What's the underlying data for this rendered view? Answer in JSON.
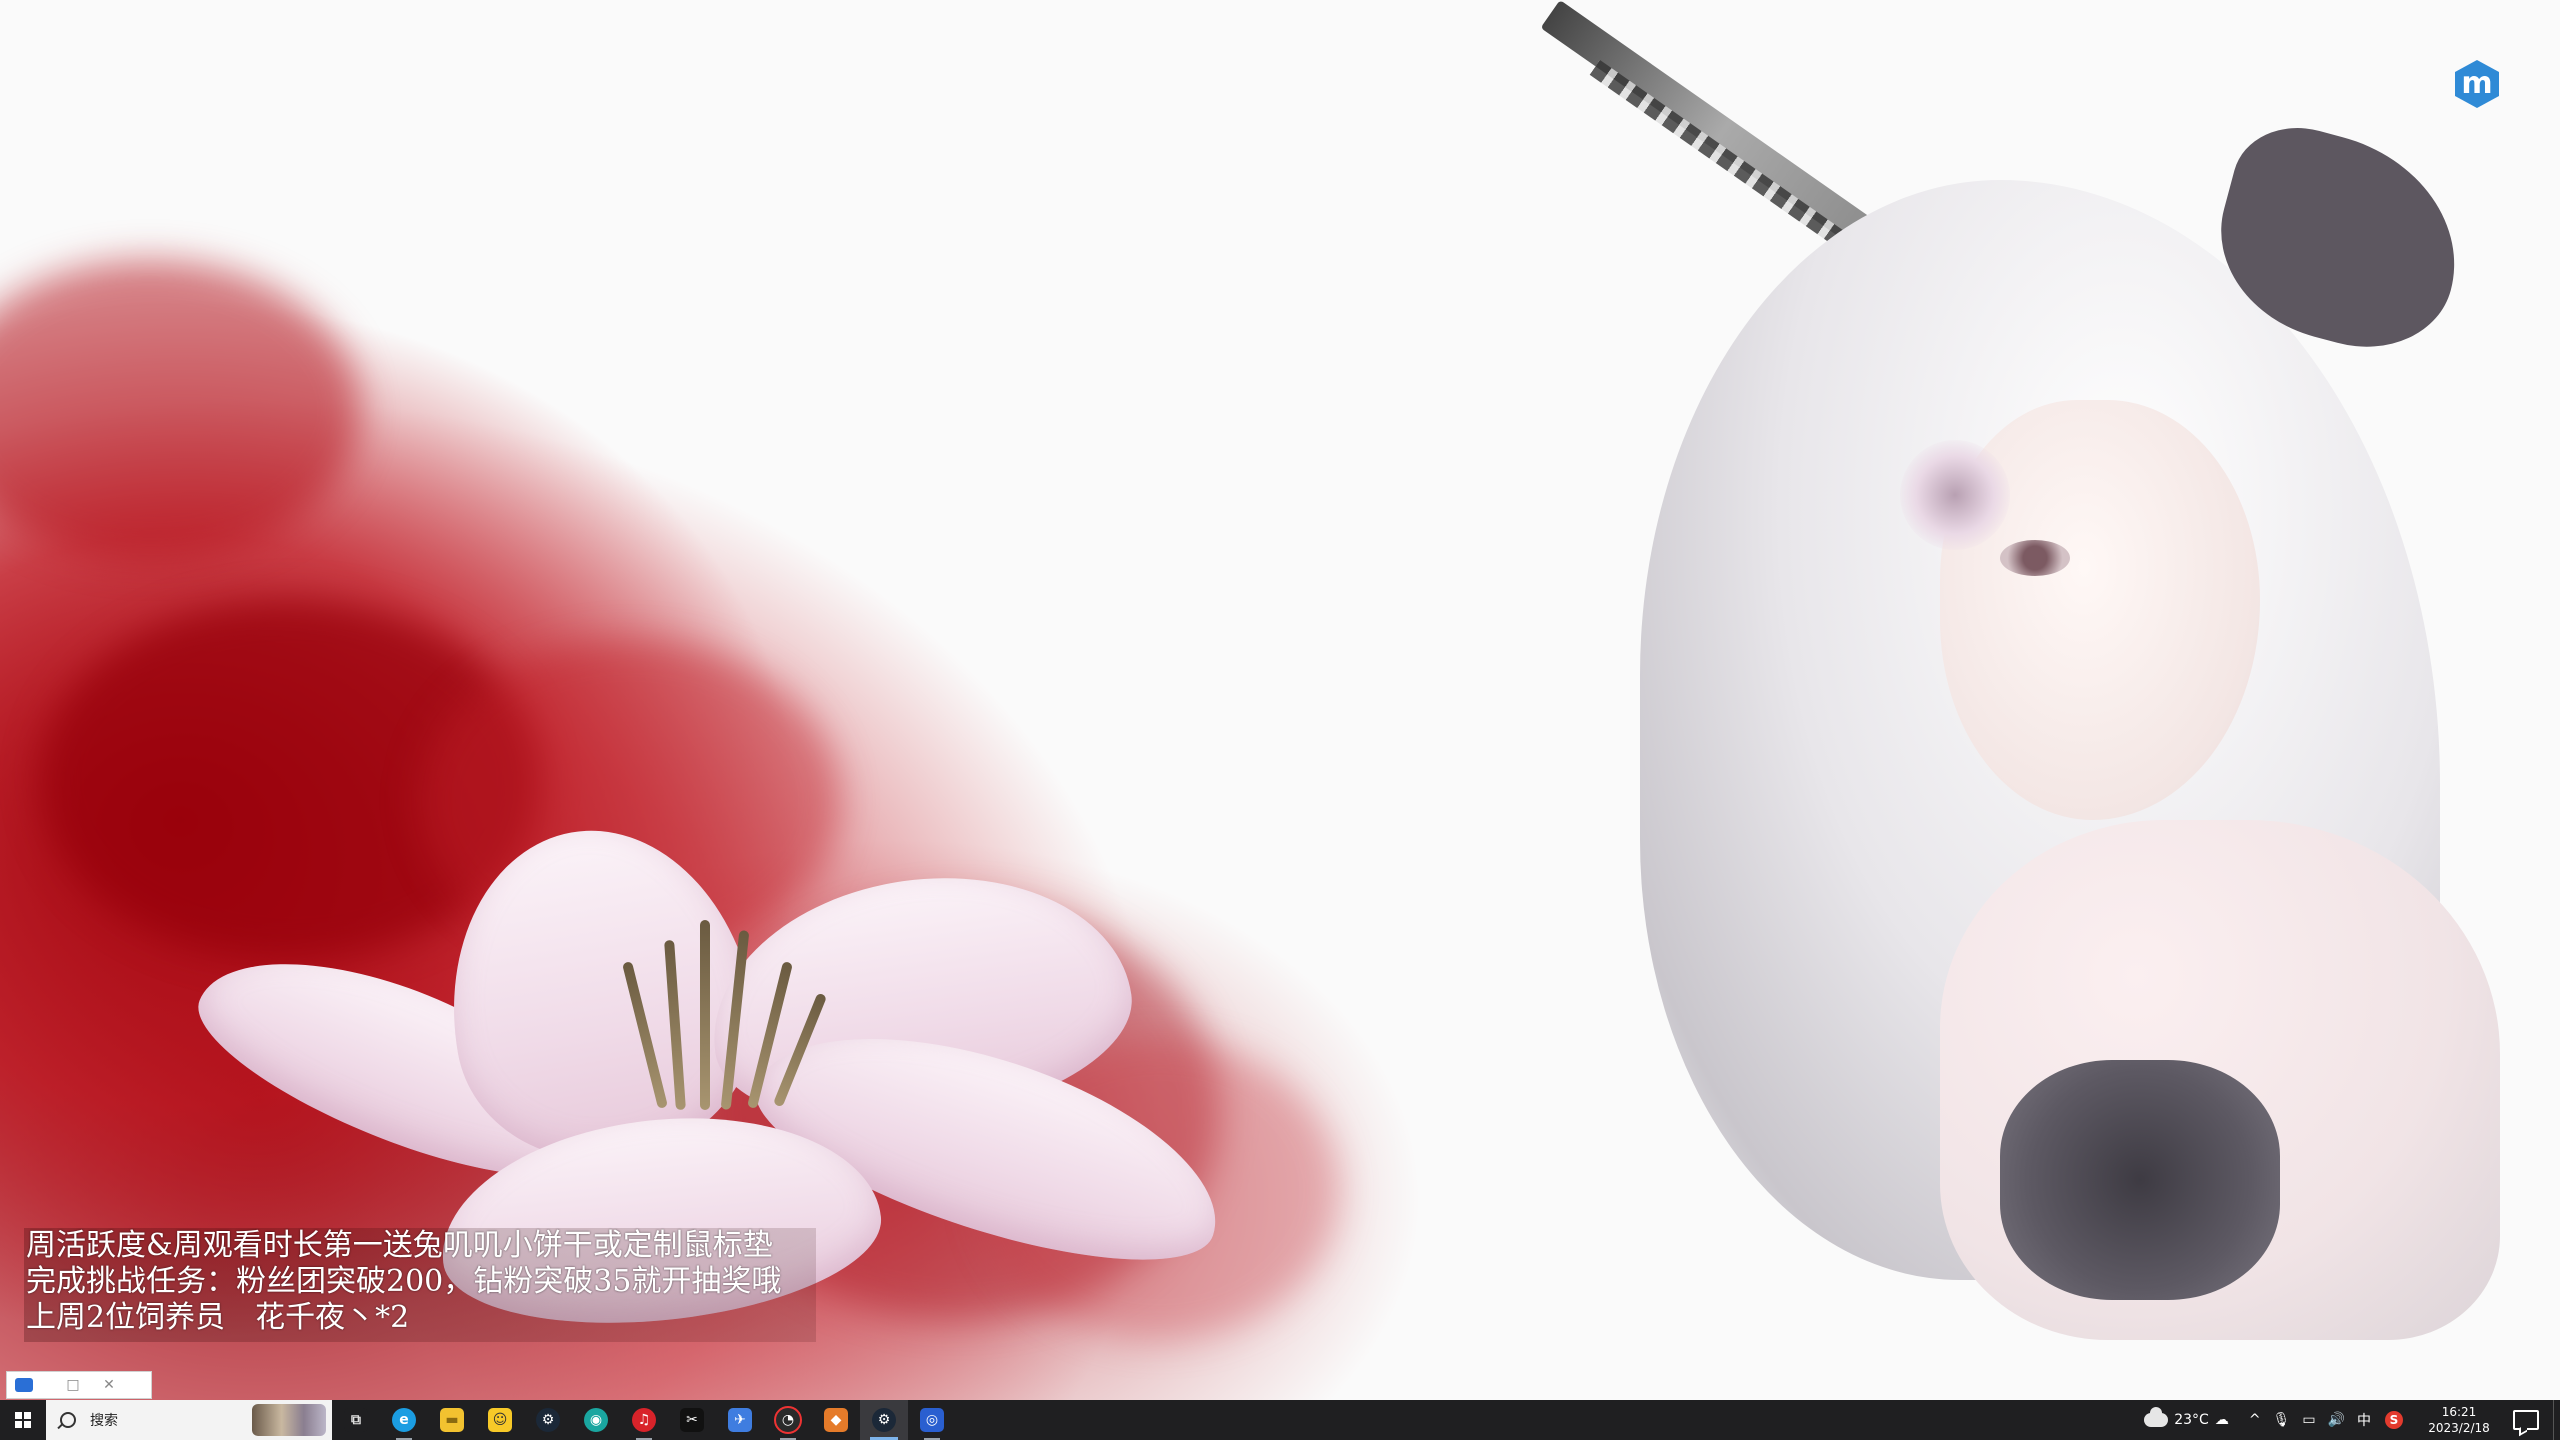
{
  "overlay": {
    "lines": [
      "周活跃度&周观看时长第一送兔叽叽小饼干或定制鼠标垫",
      "完成挑战任务：粉丝团突破200，钻粉突破35就开抽奖哦",
      "上周2位饲养员　花千夜丶*2"
    ]
  },
  "mini_window": {
    "restore_glyph": "□",
    "close_glyph": "✕"
  },
  "corner_logo": {
    "letter": "m",
    "color": "#2f8ad6"
  },
  "taskbar": {
    "search_placeholder": "搜索",
    "apps": [
      {
        "name": "task-view",
        "glyph": "⧉",
        "color": "#1f1f21"
      },
      {
        "name": "edge",
        "glyph": "e",
        "color": "#1b9de2"
      },
      {
        "name": "file-explorer",
        "glyph": "▬",
        "color": "#f2c230"
      },
      {
        "name": "qq-game",
        "glyph": "☺",
        "color": "#f7c928"
      },
      {
        "name": "steam-1",
        "glyph": "⚙",
        "color": "#1b2838"
      },
      {
        "name": "app-teal",
        "glyph": "◉",
        "color": "#1aa6a0"
      },
      {
        "name": "netease-music",
        "glyph": "♫",
        "color": "#d8232a"
      },
      {
        "name": "capcut",
        "glyph": "✂",
        "color": "#111111"
      },
      {
        "name": "app-bluebird",
        "glyph": "✈",
        "color": "#3f7de0"
      },
      {
        "name": "app-clock",
        "glyph": "◔",
        "color": "#2a2a2a"
      },
      {
        "name": "app-orange",
        "glyph": "◆",
        "color": "#e57b2a"
      },
      {
        "name": "steam-2",
        "glyph": "⚙",
        "color": "#1b2838"
      },
      {
        "name": "obs-like",
        "glyph": "◎",
        "color": "#2a5fd0"
      }
    ],
    "tray": {
      "temperature": "23°C",
      "chevron": "^",
      "ime": "中",
      "sogou": "S",
      "time": "16:21",
      "date": "2023/2/18"
    }
  }
}
